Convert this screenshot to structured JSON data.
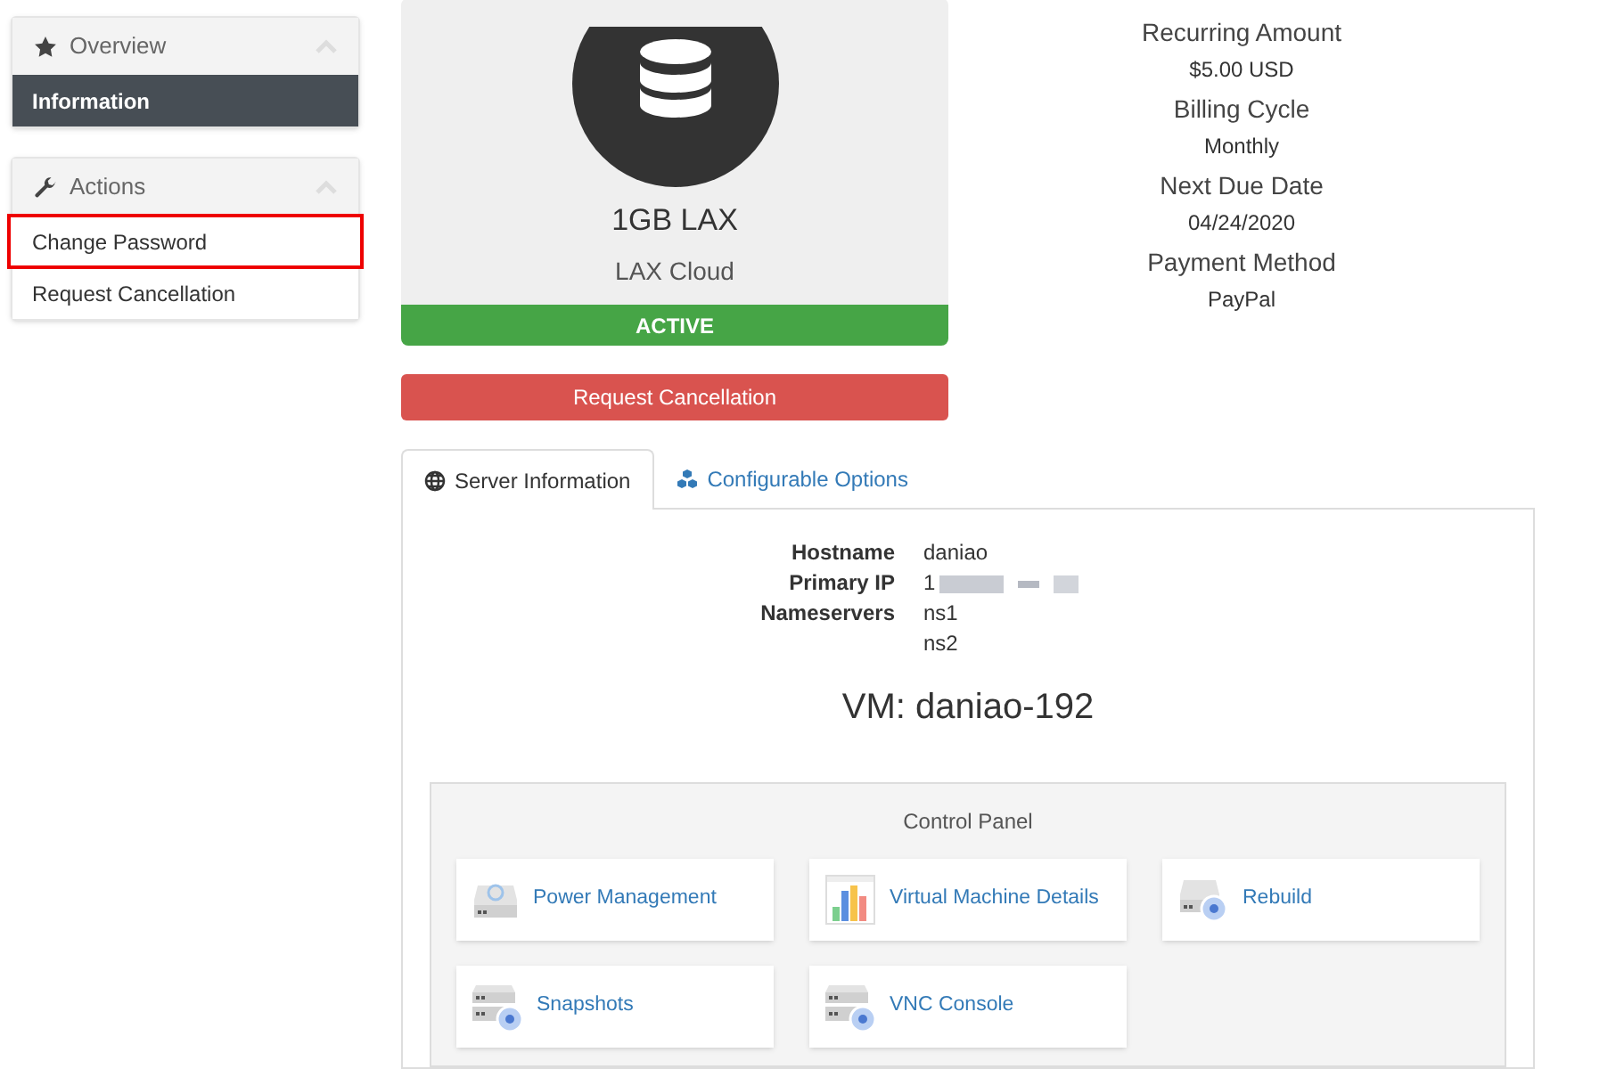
{
  "sidebar": {
    "panels": [
      {
        "title": "Overview",
        "kind": "star",
        "items": [
          {
            "label": "Information",
            "selected": true,
            "outlined": false
          }
        ]
      },
      {
        "title": "Actions",
        "kind": "wrench",
        "items": [
          {
            "label": "Change Password",
            "selected": false,
            "outlined": true
          },
          {
            "label": "Request Cancellation",
            "selected": false,
            "outlined": false
          }
        ]
      }
    ]
  },
  "product": {
    "name": "1GB LAX",
    "group": "LAX Cloud",
    "status": "ACTIVE"
  },
  "cancel_button": "Request Cancellation",
  "billing": [
    {
      "label": "Recurring Amount",
      "value": "$5.00 USD"
    },
    {
      "label": "Billing Cycle",
      "value": "Monthly"
    },
    {
      "label": "Next Due Date",
      "value": "04/24/2020"
    },
    {
      "label": "Payment Method",
      "value": "PayPal"
    }
  ],
  "tabs": [
    {
      "label": "Server Information",
      "kind": "globe",
      "selected": true
    },
    {
      "label": "Configurable Options",
      "kind": "cubes",
      "selected": false
    }
  ],
  "server_info": [
    {
      "label": "Hostname",
      "values": [
        "daniao"
      ]
    },
    {
      "label": "Primary IP",
      "values": [
        "1"
      ],
      "redacted": true
    },
    {
      "label": "Nameservers",
      "values": [
        "ns1",
        "ns2"
      ]
    }
  ],
  "vm_title": "VM: daniao-192",
  "control_panel": {
    "title": "Control Panel",
    "tiles": [
      {
        "label": "Power Management",
        "kind": "power"
      },
      {
        "label": "Virtual Machine Details",
        "kind": "chart"
      },
      {
        "label": "Rebuild",
        "kind": "rebuild"
      },
      {
        "label": "Snapshots",
        "kind": "server"
      },
      {
        "label": "VNC Console",
        "kind": "server"
      }
    ]
  }
}
